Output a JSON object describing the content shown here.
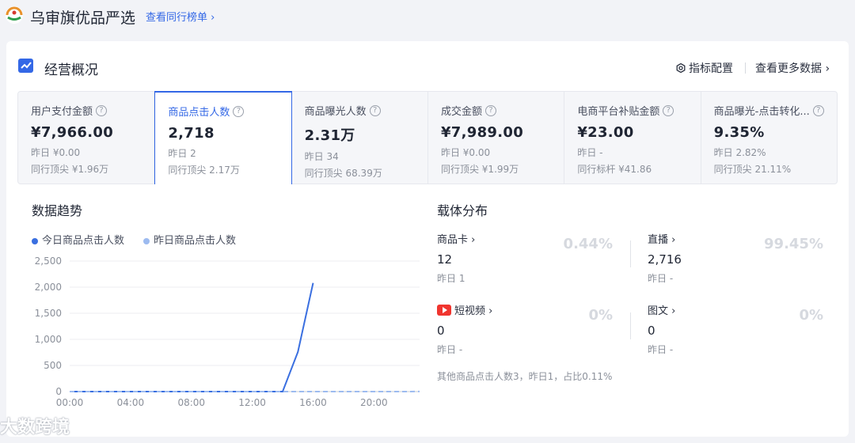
{
  "header": {
    "shop_name": "乌审旗优品严选",
    "rank_link": "查看同行榜单 ›"
  },
  "section": {
    "title": "经营概况",
    "config_label": "指标配置",
    "more_label": "查看更多数据 ›"
  },
  "metrics": [
    {
      "label": "用户支付金额",
      "value": "¥7,966.00",
      "sub1": "昨日 ¥0.00",
      "sub2": "同行顶尖 ¥1.96万"
    },
    {
      "label": "商品点击人数",
      "value": "2,718",
      "sub1": "昨日 2",
      "sub2": "同行顶尖 2.17万"
    },
    {
      "label": "商品曝光人数",
      "value": "2.31万",
      "sub1": "昨日 34",
      "sub2": "同行顶尖 68.39万"
    },
    {
      "label": "成交金额",
      "value": "¥7,989.00",
      "sub1": "昨日 ¥0.00",
      "sub2": "同行顶尖 ¥1.99万"
    },
    {
      "label": "电商平台补贴金额",
      "value": "¥23.00",
      "sub1": "昨日 -",
      "sub2": "同行标杆 ¥41.86"
    },
    {
      "label": "商品曝光-点击转化...",
      "value": "9.35%",
      "sub1": "昨日 2.82%",
      "sub2": "同行顶尖 21.11%"
    }
  ],
  "trend": {
    "title": "数据趋势",
    "legend_today": "今日商品点击人数",
    "legend_yesterday": "昨日商品点击人数"
  },
  "chart_data": {
    "type": "line",
    "title": "",
    "xlabel": "",
    "ylabel": "",
    "x_ticks": [
      "00:00",
      "04:00",
      "08:00",
      "12:00",
      "16:00",
      "20:00"
    ],
    "y_ticks": [
      "0",
      "500",
      "1,000",
      "1,500",
      "2,000",
      "2,500"
    ],
    "ylim": [
      0,
      2500
    ],
    "xlim": [
      0,
      23
    ],
    "grid": true,
    "legend_position": "top-left",
    "series": [
      {
        "name": "今日商品点击人数",
        "color": "#3a6fe0",
        "style": "solid",
        "x": [
          0,
          1,
          2,
          3,
          4,
          5,
          6,
          7,
          8,
          9,
          10,
          11,
          12,
          13,
          14,
          15,
          16
        ],
        "y": [
          0,
          0,
          0,
          0,
          0,
          0,
          0,
          0,
          0,
          0,
          0,
          0,
          0,
          0,
          0,
          760,
          2080
        ]
      },
      {
        "name": "昨日商品点击人数",
        "color": "#9dbbf0",
        "style": "dashed",
        "x": [
          0,
          1,
          2,
          3,
          4,
          5,
          6,
          7,
          8,
          9,
          10,
          11,
          12,
          13,
          14,
          15,
          16,
          17,
          18,
          19,
          20,
          21,
          22,
          23
        ],
        "y": [
          0,
          0,
          0,
          0,
          0,
          0,
          0,
          0,
          0,
          0,
          0,
          0,
          0,
          0,
          0,
          0,
          0,
          0,
          0,
          0,
          0,
          0,
          0,
          2
        ]
      }
    ]
  },
  "distribution": {
    "title": "载体分布",
    "items": [
      {
        "label": "商品卡 ›",
        "value": "12",
        "sub": "昨日 1",
        "pct": "0.44%"
      },
      {
        "label": "直播 ›",
        "value": "2,716",
        "sub": "昨日 -",
        "pct": "99.45%"
      },
      {
        "label": "短视频 ›",
        "value": "0",
        "sub": "昨日 -",
        "pct": "0%"
      },
      {
        "label": "图文 ›",
        "value": "0",
        "sub": "昨日 -",
        "pct": "0%"
      }
    ],
    "note": "其他商品点击人数3，昨日1，占比0.11%"
  },
  "watermark": "大数跨境"
}
